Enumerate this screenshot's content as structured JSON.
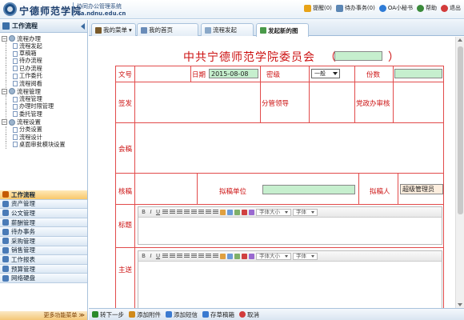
{
  "header": {
    "logo_text": "宁德师范学院",
    "system_name": "协同办公管理系统",
    "url": "oa.ndnu.edu.cn",
    "tools": [
      {
        "label": "提醒(0)",
        "icon": "bell-icon",
        "color": "#e8a317"
      },
      {
        "label": "待办事务(0)",
        "icon": "todo-icon",
        "color": "#5b86b4"
      },
      {
        "label": "OA小秘书",
        "icon": "clock-icon",
        "color": "#2e7bd6"
      },
      {
        "label": "帮助",
        "icon": "help-icon",
        "color": "#3a8a3a"
      },
      {
        "label": "退出",
        "icon": "exit-icon",
        "color": "#d23b3b"
      }
    ]
  },
  "sidebar": {
    "title": "工作流程",
    "groups": [
      {
        "label": "流程办理",
        "items": [
          "流程发起",
          "草稿箱",
          "待办流程",
          "已办流程",
          "工作委托",
          "流程阅看"
        ]
      },
      {
        "label": "流程管理",
        "items": [
          "流程管理",
          "办理时限管理",
          "委托管理"
        ]
      },
      {
        "label": "流程设置",
        "items": [
          "分类设置",
          "流程设计",
          "桌面审批模块设置"
        ]
      }
    ],
    "modules": [
      {
        "label": "工作流程",
        "active": true,
        "color": "#c45a00"
      },
      {
        "label": "资产管理",
        "active": false,
        "color": "#4a7bb7"
      },
      {
        "label": "公文管理",
        "active": false,
        "color": "#4a7bb7"
      },
      {
        "label": "薪酬管理",
        "active": false,
        "color": "#4a7bb7"
      },
      {
        "label": "待办事务",
        "active": false,
        "color": "#4a7bb7"
      },
      {
        "label": "采购管理",
        "active": false,
        "color": "#4a7bb7"
      },
      {
        "label": "销售管理",
        "active": false,
        "color": "#4a7bb7"
      },
      {
        "label": "工作报表",
        "active": false,
        "color": "#4a7bb7"
      },
      {
        "label": "预算管理",
        "active": false,
        "color": "#4a7bb7"
      },
      {
        "label": "网络硬盘",
        "active": false,
        "color": "#4a7bb7"
      }
    ],
    "more": "更多功能菜单 ≫"
  },
  "tabs": [
    {
      "label": "我的菜单",
      "active": false
    },
    {
      "label": "我的首页",
      "active": false
    },
    {
      "label": "流程发起",
      "active": false
    },
    {
      "label": "发起新的图",
      "active": true
    }
  ],
  "form": {
    "title": "中共宁德师范学院委员会",
    "paren_open": "（",
    "paren_close": "）",
    "labels": {
      "wenhao": "文号",
      "riqi": "日期",
      "miji": "密级",
      "fenshu": "份数",
      "qianfa": "签发",
      "fenguan": "分管领导",
      "dangzheng": "党政办审核",
      "huigao": "会稿",
      "hegao": "核稿",
      "nigao_danwei": "拟稿单位",
      "nigao_ren": "拟稿人",
      "biaoti": "标题",
      "zhusong": "主送"
    },
    "date_value": "2015-08-08",
    "secrecy_value": "一般",
    "drafter_value": "超级管理员",
    "editor": {
      "font_size_placeholder": "字体大小",
      "font_placeholder": "字体"
    }
  },
  "bottom_actions": [
    {
      "label": "转下一步",
      "color": "#2a8a2a"
    },
    {
      "label": "添加附件",
      "color": "#d08a1a"
    },
    {
      "label": "添加短信",
      "color": "#3a7ad0"
    },
    {
      "label": "存草稿箱",
      "color": "#3a7ad0"
    },
    {
      "label": "取消",
      "color": "#d23b3b"
    }
  ]
}
